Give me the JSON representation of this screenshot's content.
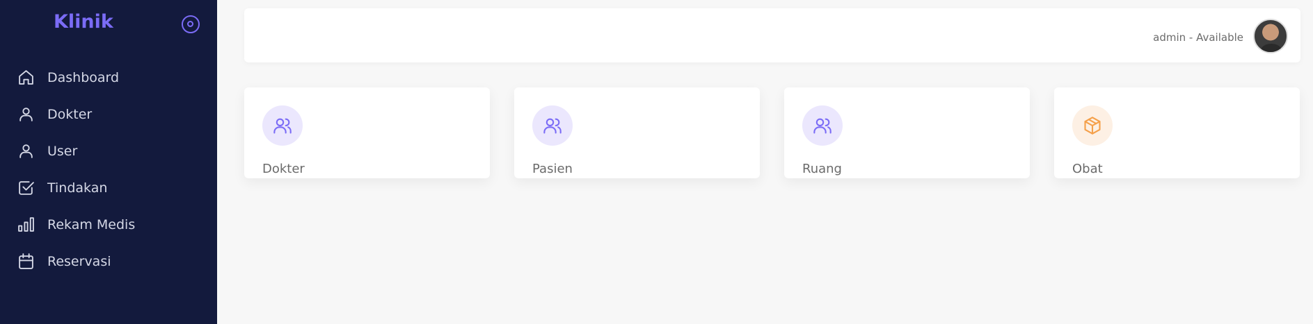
{
  "app": {
    "brand": "Klinik"
  },
  "sidebar": {
    "items": [
      {
        "label": "Dashboard",
        "icon": "home-icon"
      },
      {
        "label": "Dokter",
        "icon": "user-icon"
      },
      {
        "label": "User",
        "icon": "user-icon"
      },
      {
        "label": "Tindakan",
        "icon": "check-square-icon"
      },
      {
        "label": "Rekam Medis",
        "icon": "bar-chart-icon"
      },
      {
        "label": "Reservasi",
        "icon": "calendar-icon"
      }
    ]
  },
  "topbar": {
    "user_status": "admin - Available"
  },
  "cards": [
    {
      "label": "Dokter",
      "icon": "users-icon",
      "color": "#7b6cf6"
    },
    {
      "label": "Pasien",
      "icon": "users-icon",
      "color": "#7b6cf6"
    },
    {
      "label": "Ruang",
      "icon": "users-icon",
      "color": "#7b6cf6"
    },
    {
      "label": "Obat",
      "icon": "box-icon",
      "color": "#f5a04a"
    }
  ],
  "colors": {
    "sidebar_bg": "#131a3d",
    "accent": "#7b6cf6",
    "orange": "#f5a04a"
  }
}
